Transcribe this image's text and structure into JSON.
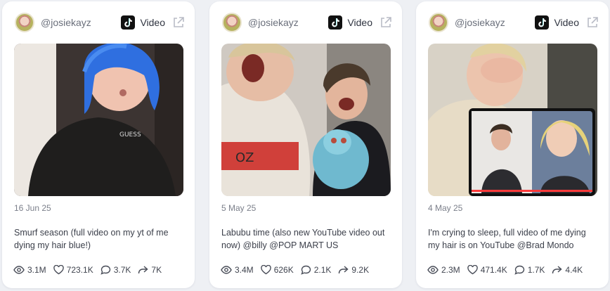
{
  "cards": [
    {
      "handle": "@josiekayz",
      "type_label": "Video",
      "date": "16 Jun 25",
      "caption": "Smurf season (full video on my yt of me dying my hair blue!)",
      "stats": {
        "views": "3.1M",
        "likes": "723.1K",
        "comments": "3.7K",
        "shares": "7K"
      },
      "thumbnail_icon": "video-thumbnail-blue-hair"
    },
    {
      "handle": "@josiekayz",
      "type_label": "Video",
      "date": "5 May 25",
      "caption": "Labubu time (also new YouTube video out now) @billy @POP MART US",
      "stats": {
        "views": "3.4M",
        "likes": "626K",
        "comments": "2.1K",
        "shares": "9.2K"
      },
      "thumbnail_icon": "video-thumbnail-labubu"
    },
    {
      "handle": "@josiekayz",
      "type_label": "Video",
      "date": "4 May 25",
      "caption": "I'm crying to sleep, full video of me dying my hair is on YouTube @Brad Mondo",
      "stats": {
        "views": "2.3M",
        "likes": "471.4K",
        "comments": "1.7K",
        "shares": "4.4K"
      },
      "thumbnail_icon": "video-thumbnail-reaction"
    }
  ],
  "colors": {
    "card_bg": "#ffffff",
    "page_bg": "#eef0f4",
    "muted_text": "#7b7f8a",
    "body_text": "#3b3f4a"
  }
}
